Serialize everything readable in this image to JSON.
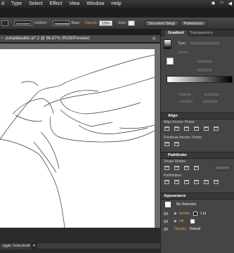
{
  "menubar": {
    "items": [
      "d",
      "Type",
      "Select",
      "Effect",
      "View",
      "Window",
      "Help"
    ]
  },
  "controlbar": {
    "stroke_profile": "Uniform",
    "brush": "Basic",
    "opacity_label": "Opacity:",
    "opacity_value": "100%",
    "style_label": "Style:",
    "document_setup": "Document Setup",
    "preferences": "Preferences"
  },
  "document": {
    "tab_title": "puhallakaikki.ai*:2 @ 66,67% (RGB/Preview)",
    "window_title": "puhallakaikki.ai*:2 @ 66,67% (RGB/Preview)"
  },
  "status": {
    "selection_tool": "oggle Selection"
  },
  "gradient_panel": {
    "tabs": [
      "Gradient",
      "Transparency"
    ],
    "type_label": "Type:",
    "stroke_label": "Stroke:",
    "opacity_label": "Opacity:",
    "location_label": "Location:"
  },
  "align_panel": {
    "title": "Align",
    "align_anchor_points": "Align Anchor Points:",
    "distribute_anchor_points": "Distribute Anchor Points:"
  },
  "pathfinder_panel": {
    "title": "Pathfinder",
    "shape_modes": "Shape Modes:",
    "pathfinders": "Pathfinders:",
    "expand_label": "Expand"
  },
  "appearance_panel": {
    "title": "Appearance",
    "selection_text": "No Selection",
    "stroke_label": "Stroke:",
    "stroke_value": "1 pt",
    "fill_label": "Fill:",
    "opacity_label": "Opacity:",
    "opacity_value": "Default"
  }
}
